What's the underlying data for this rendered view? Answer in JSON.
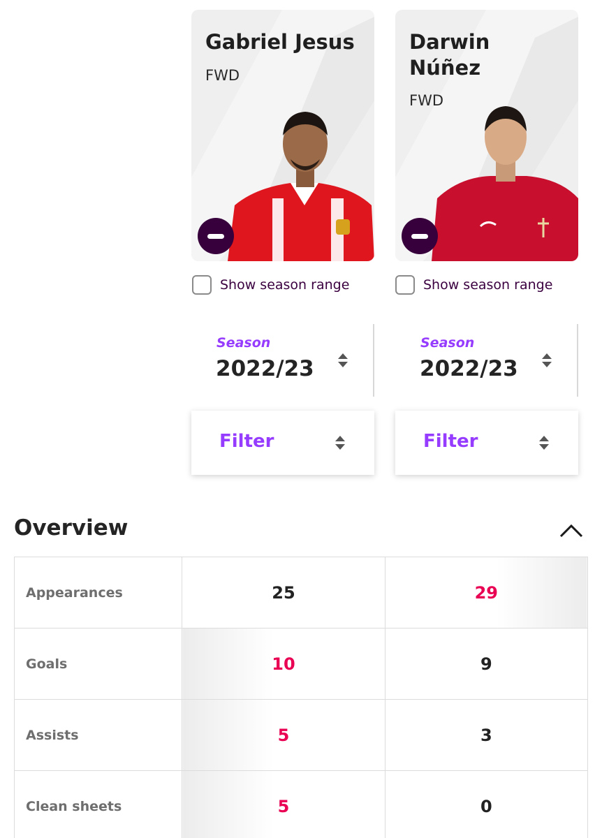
{
  "players": [
    {
      "name": "Gabriel Jesus",
      "position": "FWD",
      "shirt_color": "#e0161f",
      "remove_icon": "minus-icon",
      "season_range_label": "Show season range",
      "season_label": "Season",
      "season_value": "2022/23",
      "filter_label": "Filter"
    },
    {
      "name": "Darwin Núñez",
      "position": "FWD",
      "shirt_color": "#c8102e",
      "remove_icon": "minus-icon",
      "season_range_label": "Show season range",
      "season_label": "Season",
      "season_value": "2022/23",
      "filter_label": "Filter"
    }
  ],
  "overview": {
    "title": "Overview",
    "collapse_icon": "chevron-up-icon",
    "rows": [
      {
        "label": "Appearances",
        "values": [
          "25",
          "29"
        ],
        "best_index": 1
      },
      {
        "label": "Goals",
        "values": [
          "10",
          "9"
        ],
        "best_index": 0
      },
      {
        "label": "Assists",
        "values": [
          "5",
          "3"
        ],
        "best_index": 0
      },
      {
        "label": "Clean sheets",
        "values": [
          "5",
          "0"
        ],
        "best_index": 0
      }
    ]
  },
  "colors": {
    "brand_purple": "#37003c",
    "accent_violet": "#963cff",
    "highlight_pink": "#e90052"
  }
}
